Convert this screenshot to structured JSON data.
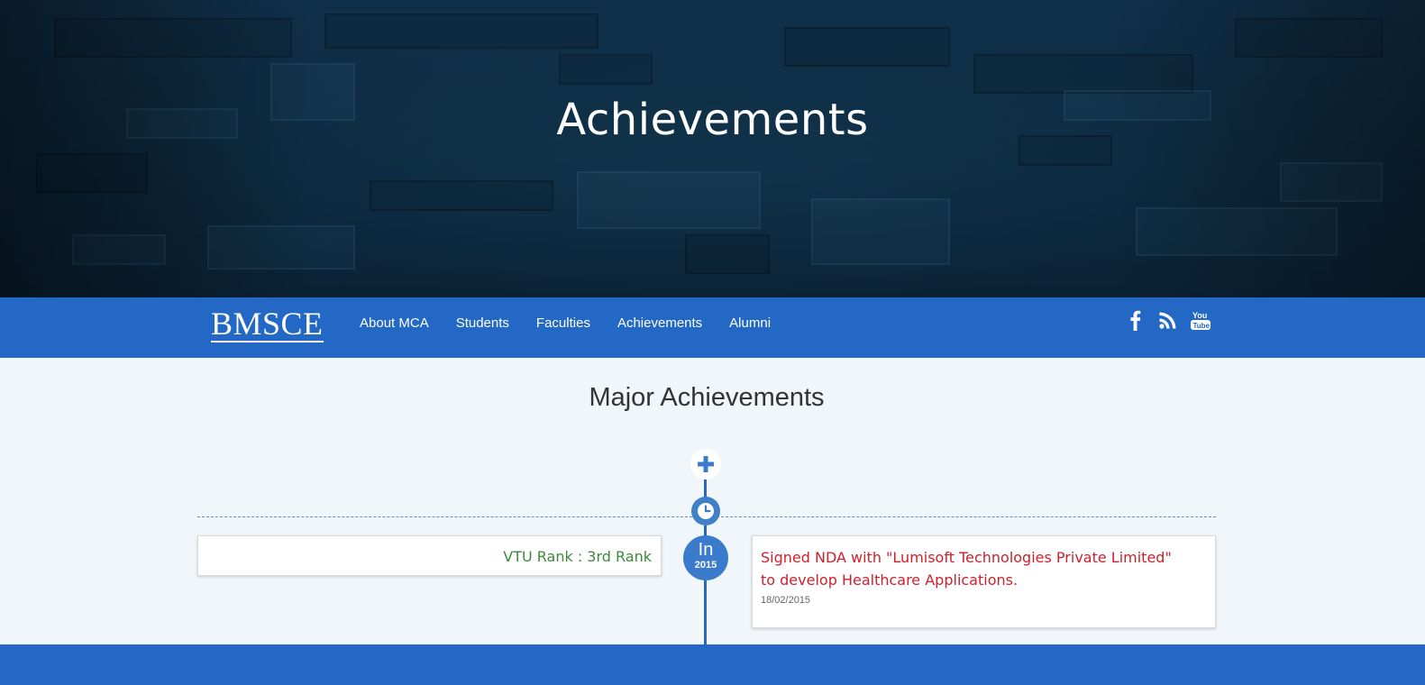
{
  "hero": {
    "title": "Achievements"
  },
  "nav": {
    "brand": "BMSCE",
    "links": [
      "About MCA",
      "Students",
      "Faculties",
      "Achievements",
      "Alumni"
    ],
    "social": [
      "facebook-icon",
      "rss-icon",
      "youtube-icon"
    ]
  },
  "main": {
    "section_title": "Major Achievements",
    "timeline": {
      "year_prefix": "In",
      "year": "2015",
      "left_item": {
        "text": "VTU Rank : 3rd Rank"
      },
      "right_item": {
        "text": "Signed NDA with \"Lumisoft Technologies Private Limited\" to develop Healthcare Applications.",
        "date": "18/02/2015"
      }
    }
  },
  "colors": {
    "nav_bg": "#2268c4",
    "timeline_accent": "#3a7ccb",
    "left_text": "#3c8a3c",
    "right_text": "#d0202c",
    "page_bg": "#f1f6fa"
  }
}
